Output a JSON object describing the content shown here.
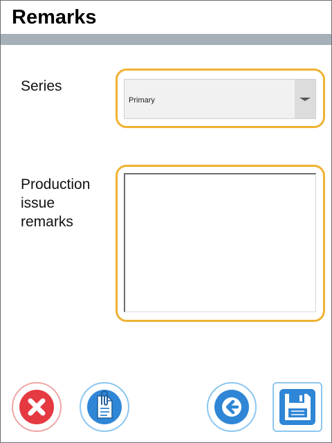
{
  "header": {
    "title": "Remarks"
  },
  "form": {
    "series": {
      "label": "Series",
      "selected_value": "Primary"
    },
    "remarks": {
      "label": "Production issue remarks",
      "value": ""
    }
  },
  "toolbar": {
    "cancel_icon": "close-icon",
    "attach_icon": "paperclip-document-icon",
    "back_icon": "arrow-left-icon",
    "save_icon": "floppy-disk-icon"
  },
  "colors": {
    "focus_ring": "#f0b130",
    "header_strip": "#a6b0b8",
    "cancel_red": "#e53a42",
    "action_blue": "#2f86d6"
  }
}
